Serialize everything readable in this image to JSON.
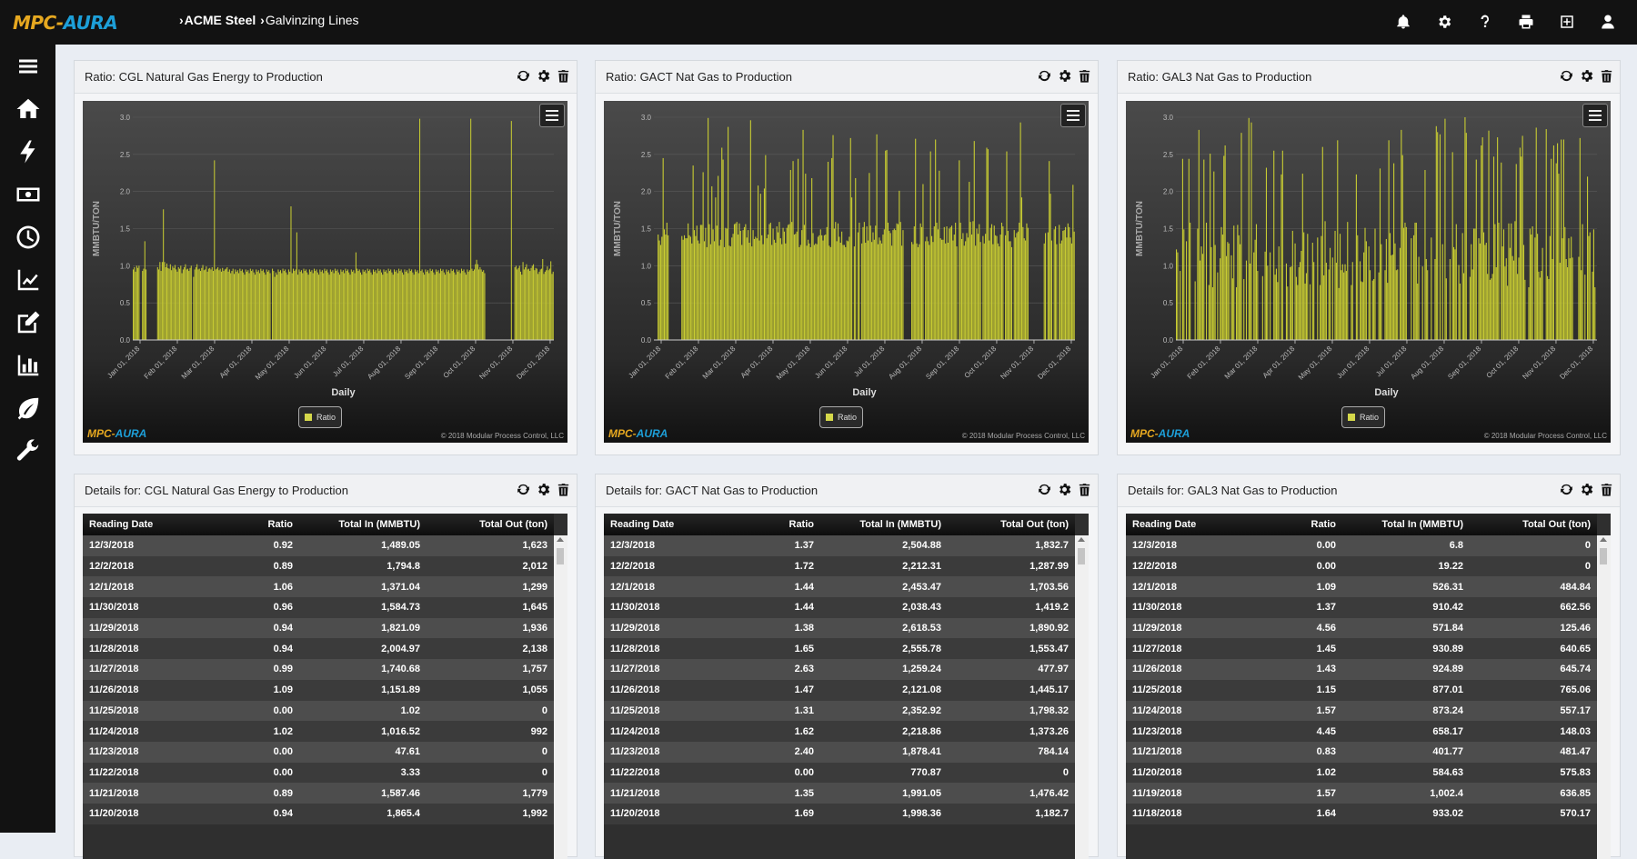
{
  "app": {
    "logo_a": "MPC-",
    "logo_b": "AURA"
  },
  "breadcrumb": {
    "first": "ACME Steel",
    "second": "Galvinzing Lines"
  },
  "topbar_icons": [
    "bell-icon",
    "gear-icon",
    "question-icon",
    "print-icon",
    "add-widget-icon",
    "user-icon"
  ],
  "sidebar_icons": [
    "menu-icon",
    "home-icon",
    "bolt-icon",
    "money-icon",
    "clock-icon",
    "line-chart-icon",
    "edit-icon",
    "bar-chart-icon",
    "leaf-icon",
    "wrench-icon"
  ],
  "colors": {
    "bar": "#c8cc32",
    "topbar": "#121212",
    "accent_orange": "#e6a820",
    "accent_blue": "#1d9fd8"
  },
  "charts": [
    {
      "title": "Ratio: CGL Natural Gas Energy to Production",
      "ylabel": "MMBTU/TON",
      "xlabel": "Daily",
      "legend": "Ratio",
      "copyright": "© 2018 Modular Process Control, LLC",
      "logo_a": "MPC-",
      "logo_b": "AURA"
    },
    {
      "title": "Ratio: GACT Nat Gas to Production",
      "ylabel": "MMBTU/TON",
      "xlabel": "Daily",
      "legend": "Ratio",
      "copyright": "© 2018 Modular Process Control, LLC",
      "logo_a": "MPC-",
      "logo_b": "AURA"
    },
    {
      "title": "Ratio: GAL3 Nat Gas to Production",
      "ylabel": "MMBTU/TON",
      "xlabel": "Daily",
      "legend": "Ratio",
      "copyright": "© 2018 Modular Process Control, LLC",
      "logo_a": "MPC-",
      "logo_b": "AURA"
    }
  ],
  "chart_data": [
    {
      "type": "bar",
      "ylim": [
        0,
        3.0
      ],
      "yticks": [
        "0.0",
        "0.5",
        "1.0",
        "1.5",
        "2.0",
        "2.5",
        "3.0"
      ],
      "xticks": [
        "Jan 01, 2018",
        "Feb 01, 2018",
        "Mar 01, 2018",
        "Apr 01, 2018",
        "May 01, 2018",
        "Jun 01, 2018",
        "Jul 01, 2018",
        "Aug 01, 2018",
        "Sep 01, 2018",
        "Oct 01, 2018",
        "Nov 01, 2018",
        "Dec 01, 2018"
      ],
      "x_range": [
        "2018-01-01",
        "2018-12-03"
      ],
      "series": [
        {
          "values": [
            0.95,
            0.98,
            0.92,
            1.0,
            0.97,
            1.0,
            0,
            0,
            0.93,
            0.96,
            1.33,
            0.95,
            0,
            0,
            0,
            0,
            0,
            0,
            0,
            0,
            0,
            0.98,
            0.95,
            1.05,
            0.93,
            1.05,
            1.76,
            1.05,
            0.98,
            1.03,
            0.97,
            0.96,
            1.02,
            0.94,
            0.99,
            0.97,
            1.01,
            0.95,
            0.92,
            0.98,
            0.96,
            1.0,
            0.9,
            0.95,
            0.98,
            1.02,
            0.95,
            0.96,
            0.93,
            0.97,
            1.0,
            0,
            0.85,
            0.95,
            0.98,
            1.02,
            0.95,
            0.96,
            0.93,
            0.97,
            1.01,
            0.94,
            0.95,
            0.99,
            0.92,
            0.96,
            0.97,
            0.95,
            0.98,
            0.93,
            2.42,
            0.95,
            0.96,
            0.98,
            0.94,
            0.96,
            0.92,
            0.97,
            0.93,
            0.95,
            0.96,
            0.98,
            0.92,
            0.95,
            0.9,
            0.93,
            0.96,
            0.89,
            0.95,
            0.92,
            0.94,
            0.9,
            0.96,
            0.93,
            0.95,
            0.91,
            0.88,
            0.95,
            0.92,
            0.94,
            0.9,
            0.96,
            0.93,
            0.95,
            0.91,
            0.88,
            0.95,
            0.92,
            0.94,
            0.9,
            0.96,
            0.93,
            0.95,
            0.91,
            0.88,
            0.95,
            0.92,
            0.94,
            0.9,
            0,
            0.96,
            0.93,
            0.85,
            0.91,
            0.88,
            0.95,
            0.92,
            0.94,
            0.9,
            0.96,
            0.93,
            0.95,
            0.91,
            0.88,
            0.95,
            0.92,
            1.8,
            0.9,
            0.96,
            0.93,
            0.95,
            1.45,
            0.88,
            0.95,
            0.92,
            0.94,
            0.9,
            0.96,
            0.93,
            0.95,
            0.91,
            0.88,
            0.95,
            0.92,
            0.94,
            0.9,
            0.96,
            0.93,
            0.95,
            0.91,
            0.88,
            0.95,
            0.92,
            0.94,
            0.9,
            0.96,
            0.93,
            0.95,
            0.91,
            0.88,
            0.95,
            0.92,
            0.94,
            0.9,
            0.96,
            0.93,
            0.95,
            0.91,
            0.88,
            0.95,
            0.92,
            0.94,
            0.9,
            0.96,
            0.93,
            0.95,
            0.91,
            0.88,
            0.95,
            0.92,
            0.94,
            0.9,
            1.18,
            0.96,
            0.93,
            0.95,
            0.91,
            0.88,
            0.95,
            0.92,
            0.94,
            0.9,
            0.96,
            0.93,
            0.95,
            0.91,
            0.88,
            0.95,
            0.92,
            0.94,
            0.9,
            0.96,
            0.93,
            0.95,
            0.91,
            0.88,
            0.95,
            0.92,
            0.94,
            0.9,
            0.96,
            0.93,
            0.95,
            0.91,
            0.88,
            0.95,
            0.92,
            0.94,
            0.9,
            0.96,
            0.93,
            0.95,
            0.91,
            0.88,
            0.95,
            0.92,
            0.94,
            0.9,
            0.96,
            0.93,
            0.95,
            0.91,
            0.88,
            0.95,
            0.92,
            0.94,
            0.9,
            2.98,
            0.93,
            0.95,
            0.91,
            0.88,
            0.95,
            0.92,
            0.94,
            0.9,
            0.96,
            0.93,
            0.95,
            0.91,
            0.88,
            0.95,
            0.92,
            0.94,
            0.9,
            0.96,
            0.93,
            0.95,
            0.91,
            0.88,
            0.95,
            0.92,
            0.94,
            0.9,
            0.96,
            0.93,
            0.95,
            0.91,
            0.88,
            0.95,
            0.92,
            0.94,
            0.9,
            0.96,
            0.93,
            0.95,
            0.91,
            0.88,
            0.95,
            0.92,
            0.94,
            2.98,
            0.96,
            0.93,
            0.95,
            1.02,
            1.08,
            1.02,
            0.95,
            0.98,
            0.95,
            0.92,
            0.94,
            0.9,
            0,
            0,
            0,
            0,
            0,
            0,
            0,
            0,
            0,
            0,
            0,
            0,
            0,
            0,
            0,
            0,
            0,
            0,
            0,
            0,
            0,
            0,
            2.95,
            0,
            0,
            0.98,
            1.0,
            0.95,
            0.97,
            1.0,
            0.92,
            0.88,
            1.05,
            0.95,
            0.98,
            1.02,
            0.95,
            0.96,
            0.93,
            0.97,
            1.0,
            1.02,
            0.94,
            0.97,
            0.96,
            0.89,
            0.92,
            0.95,
            0.96,
            1.09,
            0.89,
            0.92,
            0.94,
            0.99,
            0.94,
            0.96,
            1.06,
            0.89,
            0.92
          ]
        }
      ]
    },
    {
      "type": "bar",
      "ylim": [
        0,
        3.0
      ],
      "yticks": [
        "0.0",
        "0.5",
        "1.0",
        "1.5",
        "2.0",
        "2.5",
        "3.0"
      ],
      "xticks": [
        "Jan 01, 2018",
        "Feb 01, 2018",
        "Mar 01, 2018",
        "Apr 01, 2018",
        "May 01, 2018",
        "Jun 01, 2018",
        "Jul 01, 2018",
        "Aug 01, 2018",
        "Sep 01, 2018",
        "Oct 01, 2018",
        "Nov 01, 2018",
        "Dec 01, 2018"
      ],
      "x_range": [
        "2018-01-01",
        "2018-12-03"
      ],
      "pattern": "dense",
      "series": [
        {
          "values": []
        }
      ]
    },
    {
      "type": "bar",
      "ylim": [
        0,
        3.0
      ],
      "yticks": [
        "0.0",
        "0.5",
        "1.0",
        "1.5",
        "2.0",
        "2.5",
        "3.0"
      ],
      "xticks": [
        "Jan 01, 2018",
        "Feb 01, 2018",
        "Mar 01, 2018",
        "Apr 01, 2018",
        "May 01, 2018",
        "Jun 01, 2018",
        "Jul 01, 2018",
        "Aug 01, 2018",
        "Sep 01, 2018",
        "Oct 01, 2018",
        "Nov 01, 2018",
        "Dec 01, 2018"
      ],
      "x_range": [
        "2018-01-01",
        "2018-12-03"
      ],
      "pattern": "sparse",
      "series": [
        {
          "values": []
        }
      ]
    }
  ],
  "details": [
    {
      "title": "Details for: CGL Natural Gas Energy to Production",
      "columns": [
        "Reading Date",
        "Ratio",
        "Total In (MMBTU)",
        "Total Out (ton)"
      ],
      "rows": [
        [
          "12/3/2018",
          "0.92",
          "1,489.05",
          "1,623"
        ],
        [
          "12/2/2018",
          "0.89",
          "1,794.8",
          "2,012"
        ],
        [
          "12/1/2018",
          "1.06",
          "1,371.04",
          "1,299"
        ],
        [
          "11/30/2018",
          "0.96",
          "1,584.73",
          "1,645"
        ],
        [
          "11/29/2018",
          "0.94",
          "1,821.09",
          "1,936"
        ],
        [
          "11/28/2018",
          "0.94",
          "2,004.97",
          "2,138"
        ],
        [
          "11/27/2018",
          "0.99",
          "1,740.68",
          "1,757"
        ],
        [
          "11/26/2018",
          "1.09",
          "1,151.89",
          "1,055"
        ],
        [
          "11/25/2018",
          "0.00",
          "1.02",
          "0"
        ],
        [
          "11/24/2018",
          "1.02",
          "1,016.52",
          "992"
        ],
        [
          "11/23/2018",
          "0.00",
          "47.61",
          "0"
        ],
        [
          "11/22/2018",
          "0.00",
          "3.33",
          "0"
        ],
        [
          "11/21/2018",
          "0.89",
          "1,587.46",
          "1,779"
        ],
        [
          "11/20/2018",
          "0.94",
          "1,865.4",
          "1,992"
        ]
      ]
    },
    {
      "title": "Details for: GACT Nat Gas to Production",
      "columns": [
        "Reading Date",
        "Ratio",
        "Total In (MMBTU)",
        "Total Out (ton)"
      ],
      "rows": [
        [
          "12/3/2018",
          "1.37",
          "2,504.88",
          "1,832.7"
        ],
        [
          "12/2/2018",
          "1.72",
          "2,212.31",
          "1,287.99"
        ],
        [
          "12/1/2018",
          "1.44",
          "2,453.47",
          "1,703.56"
        ],
        [
          "11/30/2018",
          "1.44",
          "2,038.43",
          "1,419.2"
        ],
        [
          "11/29/2018",
          "1.38",
          "2,618.53",
          "1,890.92"
        ],
        [
          "11/28/2018",
          "1.65",
          "2,555.78",
          "1,553.47"
        ],
        [
          "11/27/2018",
          "2.63",
          "1,259.24",
          "477.97"
        ],
        [
          "11/26/2018",
          "1.47",
          "2,121.08",
          "1,445.17"
        ],
        [
          "11/25/2018",
          "1.31",
          "2,352.92",
          "1,798.32"
        ],
        [
          "11/24/2018",
          "1.62",
          "2,218.86",
          "1,373.26"
        ],
        [
          "11/23/2018",
          "2.40",
          "1,878.41",
          "784.14"
        ],
        [
          "11/22/2018",
          "0.00",
          "770.87",
          "0"
        ],
        [
          "11/21/2018",
          "1.35",
          "1,991.05",
          "1,476.42"
        ],
        [
          "11/20/2018",
          "1.69",
          "1,998.36",
          "1,182.7"
        ]
      ]
    },
    {
      "title": "Details for: GAL3 Nat Gas to Production",
      "columns": [
        "Reading Date",
        "Ratio",
        "Total In (MMBTU)",
        "Total Out (ton)"
      ],
      "rows": [
        [
          "12/3/2018",
          "0.00",
          "6.8",
          "0"
        ],
        [
          "12/2/2018",
          "0.00",
          "19.22",
          "0"
        ],
        [
          "12/1/2018",
          "1.09",
          "526.31",
          "484.84"
        ],
        [
          "11/30/2018",
          "1.37",
          "910.42",
          "662.56"
        ],
        [
          "11/29/2018",
          "4.56",
          "571.84",
          "125.46"
        ],
        [
          "11/27/2018",
          "1.45",
          "930.89",
          "640.65"
        ],
        [
          "11/26/2018",
          "1.43",
          "924.89",
          "645.74"
        ],
        [
          "11/25/2018",
          "1.15",
          "877.01",
          "765.06"
        ],
        [
          "11/24/2018",
          "1.57",
          "873.24",
          "557.17"
        ],
        [
          "11/23/2018",
          "4.45",
          "658.17",
          "148.03"
        ],
        [
          "11/21/2018",
          "0.83",
          "401.77",
          "481.47"
        ],
        [
          "11/20/2018",
          "1.02",
          "584.63",
          "575.83"
        ],
        [
          "11/19/2018",
          "1.57",
          "1,002.4",
          "636.85"
        ],
        [
          "11/18/2018",
          "1.64",
          "933.02",
          "570.17"
        ]
      ]
    }
  ]
}
